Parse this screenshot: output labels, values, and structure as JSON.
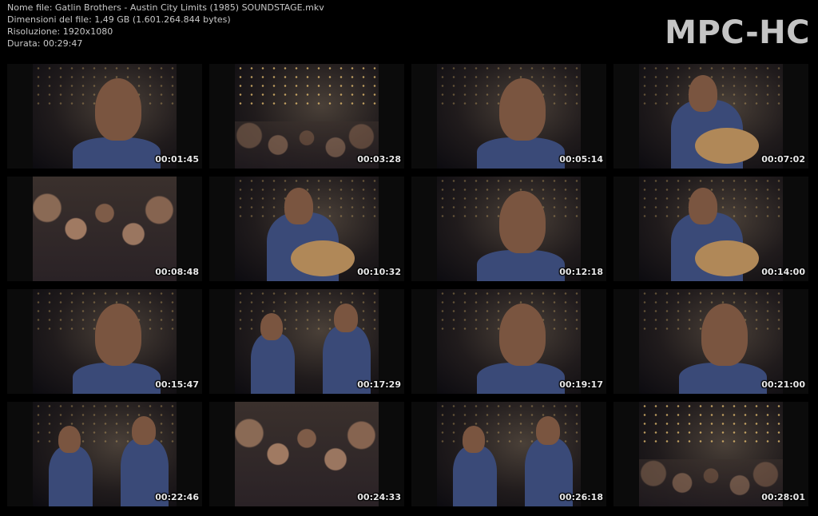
{
  "info": {
    "filename": "Nome file: Gatlin Brothers - Austin City Limits (1985) SOUNDSTAGE.mkv",
    "filesize": "Dimensioni del file: 1,49 GB (1.601.264.844 bytes)",
    "resolution": "Risoluzione: 1920x1080",
    "duration": "Durata: 00:29:47"
  },
  "logo": "MPC-HC",
  "thumbnails": [
    {
      "timestamp": "00:01:45",
      "scene": "singer-closeup"
    },
    {
      "timestamp": "00:03:28",
      "scene": "wide-stage"
    },
    {
      "timestamp": "00:05:14",
      "scene": "singer-closeup"
    },
    {
      "timestamp": "00:07:02",
      "scene": "guitarist"
    },
    {
      "timestamp": "00:08:48",
      "scene": "audience"
    },
    {
      "timestamp": "00:10:32",
      "scene": "guitarist"
    },
    {
      "timestamp": "00:12:18",
      "scene": "singer-closeup"
    },
    {
      "timestamp": "00:14:00",
      "scene": "fiddler"
    },
    {
      "timestamp": "00:15:47",
      "scene": "singer-profile"
    },
    {
      "timestamp": "00:17:29",
      "scene": "band"
    },
    {
      "timestamp": "00:19:17",
      "scene": "singer-closeup"
    },
    {
      "timestamp": "00:21:00",
      "scene": "singer-profile"
    },
    {
      "timestamp": "00:22:46",
      "scene": "band"
    },
    {
      "timestamp": "00:24:33",
      "scene": "audience"
    },
    {
      "timestamp": "00:26:18",
      "scene": "band"
    },
    {
      "timestamp": "00:28:01",
      "scene": "wide-stage"
    }
  ]
}
